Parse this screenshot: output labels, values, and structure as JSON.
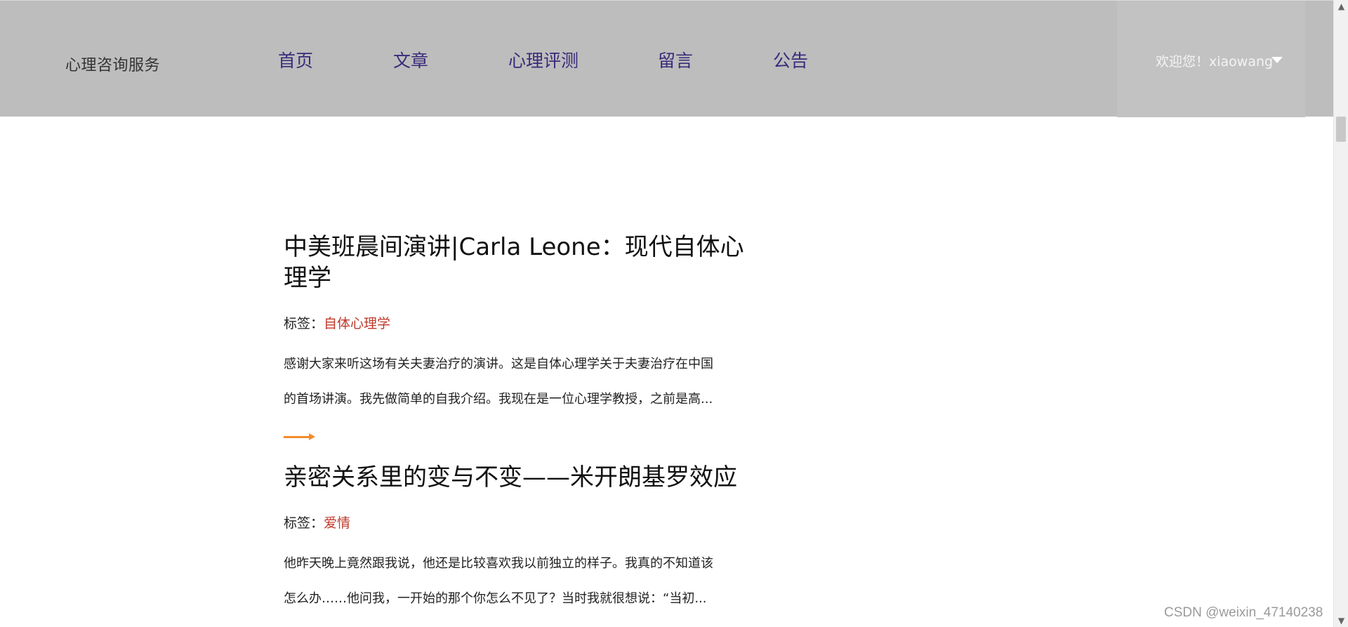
{
  "header": {
    "brand": "心理咨询服务",
    "nav": [
      {
        "label": "首页"
      },
      {
        "label": "文章"
      },
      {
        "label": "心理评测"
      },
      {
        "label": "留言"
      },
      {
        "label": "公告"
      }
    ],
    "user_greeting": "欢迎您！xiaowang"
  },
  "articles": [
    {
      "title": "中美班晨间演讲|Carla Leone：现代自体心理学",
      "tags_label": "标签：",
      "tag": "自体心理学",
      "excerpt_line1": "感谢大家来听这场有关夫妻治疗的演讲。这是自体心理学关于夫妻治疗在中国",
      "excerpt_line2": "的首场讲演。我先做简单的自我介绍。我现在是一位心理学教授，之前是高..."
    },
    {
      "title": "亲密关系里的变与不变——米开朗基罗效应",
      "tags_label": "标签：",
      "tag": "爱情",
      "excerpt_line1": "他昨天晚上竟然跟我说，他还是比较喜欢我以前独立的样子。我真的不知道该",
      "excerpt_line2": "怎么办……他问我，一开始的那个你怎么不见了？当时我就很想说：“当初..."
    }
  ],
  "watermark": "CSDN @weixin_47140238",
  "colors": {
    "header_bg": "#bdbdbd",
    "nav_text": "#3a2a7a",
    "tag": "#c0392b",
    "arrow": "#f28c2b"
  },
  "icons": {
    "user_menu": "caret-down-icon",
    "read_more": "arrow-right-icon"
  }
}
